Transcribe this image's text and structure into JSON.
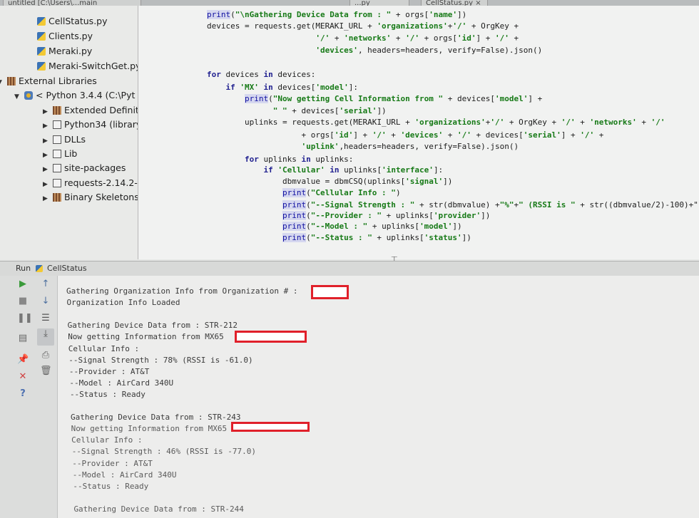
{
  "tabs": [
    {
      "label": "untitled [C:\\Users\\...main"
    },
    {
      "label": "...py"
    },
    {
      "label": "CellStatus.py",
      "close": "×"
    }
  ],
  "project_tree": {
    "items": [
      {
        "label": "CellStatus.py",
        "icon": "python-file-icon"
      },
      {
        "label": "Clients.py",
        "icon": "python-file-icon"
      },
      {
        "label": "Meraki.py",
        "icon": "python-file-icon"
      },
      {
        "label": "Meraki-SwitchGet.py",
        "icon": "python-file-icon"
      },
      {
        "label": "External Libraries",
        "icon": "library-icon",
        "arrow": "▼"
      },
      {
        "label": "< Python 3.4.4 (C:\\Pyt",
        "icon": "python-sdk-icon",
        "arrow": "▼"
      },
      {
        "label": "Extended Definitio",
        "icon": "library-icon",
        "arrow": "▶"
      },
      {
        "label": "Python34 (library h",
        "icon": "folder-icon",
        "arrow": "▶"
      },
      {
        "label": "DLLs",
        "icon": "folder-icon",
        "arrow": "▶"
      },
      {
        "label": "Lib",
        "icon": "folder-icon",
        "arrow": "▶"
      },
      {
        "label": "site-packages",
        "icon": "folder-icon",
        "arrow": "▶"
      },
      {
        "label": "requests-2.14.2-py",
        "icon": "folder-icon",
        "arrow": "▶"
      },
      {
        "label": "Binary Skeletons",
        "icon": "library-icon",
        "arrow": "▶"
      }
    ]
  },
  "code_lines": [
    "print(\"\\nGathering Device Data from : \" + orgs['name'])",
    "devices = requests.get(MERAKI_URL + 'organizations'+'/' + OrgKey +",
    "                       '/' + 'networks' + '/' + orgs['id'] + '/' +",
    "                       'devices', headers=headers, verify=False).json()",
    "",
    "for devices in devices:",
    "    if 'MX' in devices['model']:",
    "        print(\"Now getting Cell Information from \" + devices['model'] +",
    "              \" \" + devices['serial'])",
    "        uplinks = requests.get(MERAKI_URL + 'organizations'+'/' + OrgKey + '/' + 'networks' + '/'",
    "                    + orgs['id'] + '/' + 'devices' + '/' + devices['serial'] + '/' +",
    "                    'uplink',headers=headers, verify=False).json()",
    "        for uplinks in uplinks:",
    "            if 'Cellular' in uplinks['interface']:",
    "                dbmvalue = dbmCSQ(uplinks['signal'])",
    "                print(\"Cellular Info : \")",
    "                print(\"--Signal Strength : \" + str(dbmvalue) +\"%\"+\" (RSSI is \" + str((dbmvalue/2)-100)+\"",
    "                print(\"--Provider : \" + uplinks['provider'])",
    "                print(\"--Model : \" + uplinks['model'])",
    "                print(\"--Status : \" + uplinks['status'])"
  ],
  "run_panel": {
    "run_label": "Run",
    "config_name": "CellStatus"
  },
  "console_lines": [
    "Gathering Organization Info from Organization # :",
    "Organization Info Loaded",
    "",
    "Gathering Device Data from : STR-212",
    "Now getting Information from MX65",
    "Cellular Info :",
    "--Signal Strength : 78% (RSSI is -61.0)",
    "--Provider : AT&T",
    "--Model : AirCard 340U",
    "--Status : Ready",
    "",
    "Gathering Device Data from : STR-243",
    "Now getting Information from MX65",
    "Cellular Info :",
    "--Signal Strength : 46% (RSSI is -77.0)",
    "--Provider : AT&T",
    "--Model : AirCard 340U",
    "--Status : Ready",
    "",
    "Gathering Device Data from : STR-244"
  ],
  "colors": {
    "keyword": "#1f1f8f",
    "string": "#177a17",
    "redaction": "#e0202a",
    "run_green": "#3a9a3a"
  }
}
